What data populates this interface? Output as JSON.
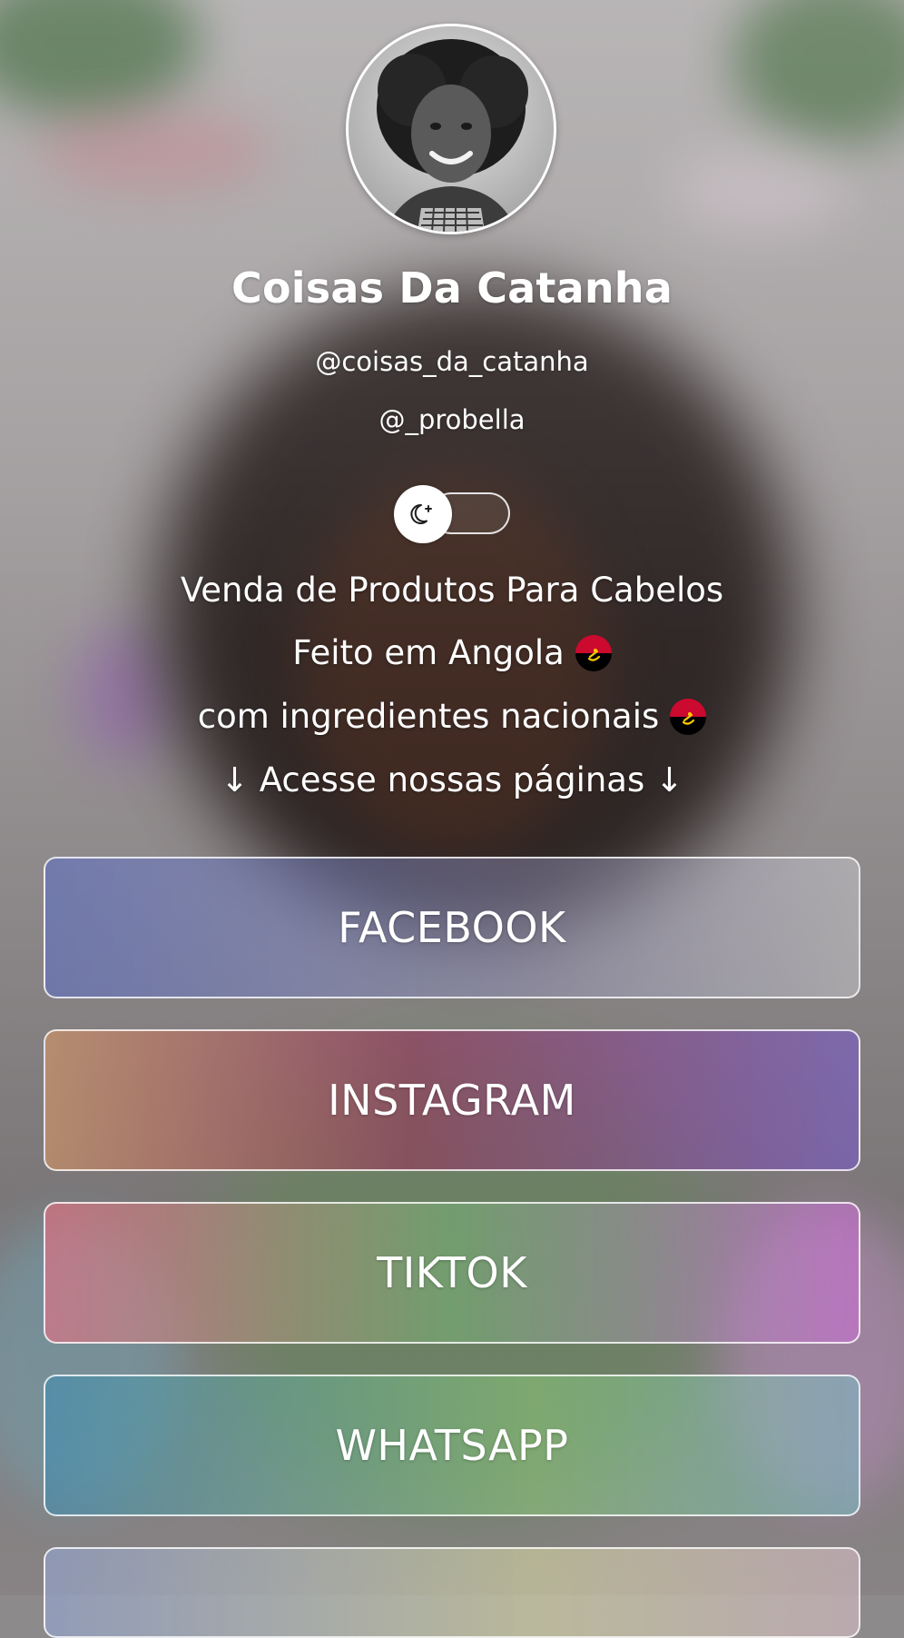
{
  "profile": {
    "name": "Coisas Da Catanha",
    "handles": [
      "@coisas_da_catanha",
      "@_probella"
    ],
    "avatar_icon": "profile-photo"
  },
  "theme_toggle": {
    "icon": "moon-sparkle-icon",
    "state": "light"
  },
  "bio": {
    "line1": "Venda de Produtos Para Cabelos",
    "line2": "Feito em Angola",
    "line3": "com ingredientes nacionais",
    "line4": "↓ Acesse nossas páginas ↓",
    "flag": "angola-flag"
  },
  "links": [
    {
      "label": "FACEBOOK"
    },
    {
      "label": "INSTAGRAM"
    },
    {
      "label": "TIKTOK"
    },
    {
      "label": "WHATSAPP"
    },
    {
      "label": ""
    }
  ],
  "colors": {
    "text": "#ffffff",
    "angola_red": "#cc092f",
    "angola_black": "#000000",
    "angola_yellow": "#ffcb00"
  }
}
